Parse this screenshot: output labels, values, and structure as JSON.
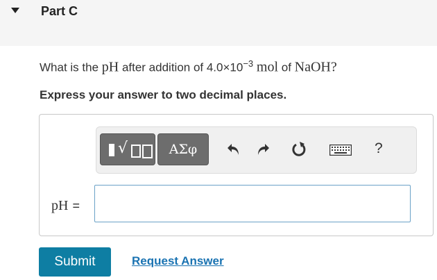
{
  "part": {
    "title": "Part C"
  },
  "question": {
    "prefix": "What is the ",
    "ph": "pH",
    "middle": " after addition of 4.0×10",
    "exponent": "−3",
    "space": " ",
    "unit": "mol",
    "of": " of ",
    "compound": "NaOH",
    "end": "?"
  },
  "instruction": "Express your answer to two decimal places.",
  "toolbar": {
    "templates_icon": "templates-icon",
    "greek_label": "ΑΣφ",
    "undo_icon": "undo-icon",
    "redo_icon": "redo-icon",
    "reset_icon": "reset-icon",
    "keyboard_icon": "keyboard-icon",
    "help_label": "?"
  },
  "answer": {
    "label": "pH",
    "equals": "=",
    "value": ""
  },
  "actions": {
    "submit_label": "Submit",
    "request_label": "Request Answer"
  },
  "colors": {
    "submit_bg": "#0e7ea3",
    "link": "#1a73b2",
    "input_border": "#6aa1c7"
  }
}
